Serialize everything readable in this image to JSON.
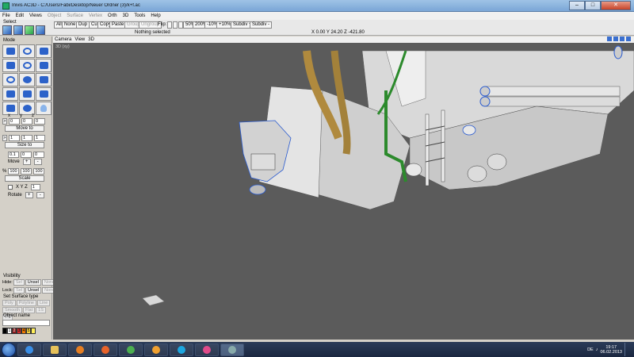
{
  "window": {
    "title": "Inivis AC3D - C:/Users/Fabi/Desktop/Neuer Ordner (3)/k+f.ac"
  },
  "menu": [
    "File",
    "Edit",
    "Views",
    "Object",
    "Surface",
    "Vertex",
    "Orth",
    "3D",
    "Tools",
    "Help"
  ],
  "menu_disabled": [
    "Object",
    "Surface",
    "Vertex"
  ],
  "toolbar": {
    "select_label": "Select",
    "all": "All",
    "none": "None",
    "dup": "Dup",
    "cut": "Cut",
    "copy": "Copy",
    "paste": "Paste",
    "group": "Group",
    "ungroup": "Ungroup",
    "flip": "Flip:",
    "zoom50": "50%",
    "zoom200": "200%",
    "minus10": "-10%",
    "plus10": "+10%",
    "subdiv1": "Subdiv +",
    "subdiv2": "Subdiv -",
    "status": "Nothing selected",
    "coords": "X 0.00 Y 24.20 Z -421.80"
  },
  "panel": {
    "mode_label": "Mode",
    "xyz": [
      "x",
      "y",
      "z"
    ],
    "move_values": [
      "0",
      "0",
      "0"
    ],
    "move_to": "Move to",
    "size_values": [
      "1",
      "1",
      "1"
    ],
    "size_to": "Size to",
    "step_values": [
      "0.1",
      "0",
      "0"
    ],
    "move": "Move",
    "scale_values": [
      "100",
      "100",
      "100"
    ],
    "scale": "Scale",
    "rotate_axes": "X Y Z",
    "rotate_value": "1",
    "rotate": "Rotate",
    "visibility": "Visibility",
    "hide": "Hide:",
    "lock": "Lock:",
    "sel": "Sel",
    "unsel": "Unsel",
    "none": "None",
    "surface_type": "Set Surface type",
    "surf_btns": [
      "Poly",
      "Polyline",
      "Line",
      "Smooth",
      "Flat",
      "1S",
      "2S"
    ],
    "object_name": "Object name",
    "palette": [
      "1",
      "2",
      "3",
      "4",
      "5"
    ],
    "palette_colors": [
      "#000000",
      "#ffffff",
      "#c0392b",
      "#e74c3c",
      "#e67e22",
      "#f1c40f",
      "#ffeb3b"
    ]
  },
  "viewport": {
    "tabs": [
      "Camera",
      "View",
      "3D"
    ],
    "label": "3D (xy)"
  },
  "taskbar": {
    "time": "19:17",
    "date": "06.02.2013",
    "lang": "DE"
  }
}
